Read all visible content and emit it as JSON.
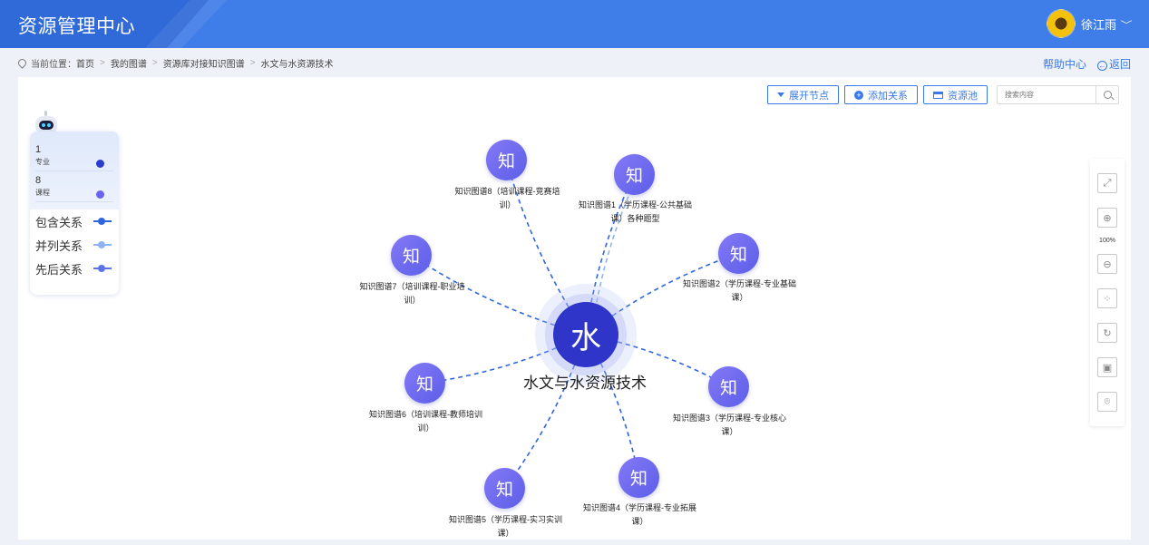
{
  "header": {
    "app_title": "资源管理中心",
    "user_name": "徐江雨",
    "chevron": "﹀"
  },
  "breadcrumb": {
    "prefix": "当前位置：",
    "items": [
      "首页",
      "我的图谱",
      "资源库对接知识图谱",
      "水文与水资源技术"
    ],
    "separator": ">"
  },
  "top_links": {
    "help": "帮助中心",
    "back": "返回"
  },
  "toolbar": {
    "expand_label": "展开节点",
    "add_relation_label": "添加关系",
    "resource_pool_label": "资源池",
    "search_placeholder": "搜索内容"
  },
  "legend": {
    "stats": [
      {
        "count": "1",
        "label": "专业",
        "color": "#2c3bd0"
      },
      {
        "count": "8",
        "label": "课程",
        "color": "#6a62f0"
      }
    ],
    "relations": [
      {
        "label": "包含关系",
        "color": "#2f66e0"
      },
      {
        "label": "并列关系",
        "color": "#8fb3f0"
      },
      {
        "label": "先后关系",
        "color": "#5a74e8"
      }
    ]
  },
  "side_tools": {
    "zoom_label": "100%",
    "icons": [
      "fullscreen-icon",
      "zoom-in-icon",
      "zoom-out-icon",
      "layout-icon",
      "refresh-icon",
      "image-icon",
      "locate-icon"
    ]
  },
  "graph": {
    "center": {
      "glyph": "水",
      "label": "水文与水资源技术"
    },
    "node_glyph": "知",
    "nodes": [
      {
        "id": "kg1",
        "line1": "知识图谱1（学历课程-公共基础",
        "line2": "课）各种题型"
      },
      {
        "id": "kg2",
        "line1": "知识图谱2（学历课程-专业基础",
        "line2": "课）"
      },
      {
        "id": "kg3",
        "line1": "知识图谱3（学历课程-专业核心",
        "line2": "课）"
      },
      {
        "id": "kg4",
        "line1": "知识图谱4（学历课程-专业拓展",
        "line2": "课）"
      },
      {
        "id": "kg5",
        "line1": "知识图谱5（学历课程-实习实训",
        "line2": "课）"
      },
      {
        "id": "kg6",
        "line1": "知识图谱6（培训课程-教师培训",
        "line2": "训）"
      },
      {
        "id": "kg7",
        "line1": "知识图谱7（培训课程-职业培",
        "line2": "训）"
      },
      {
        "id": "kg8",
        "line1": "知识图谱8（培训课程-竞赛培",
        "line2": "训）"
      }
    ],
    "edge_color": "#2f66e0",
    "edge_color_light": "#8fb3f0"
  }
}
